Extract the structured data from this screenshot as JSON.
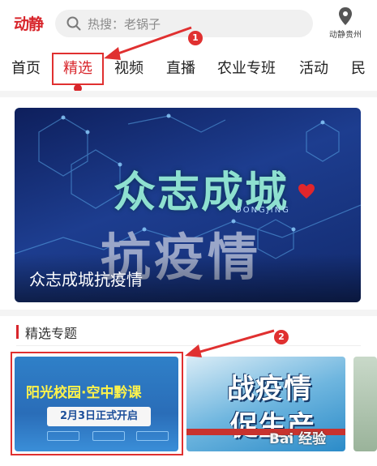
{
  "header": {
    "logo": "动静",
    "search_placeholder": "热搜：老锅子",
    "location_label": "动静贵州"
  },
  "tabs": [
    "首页",
    "精选",
    "视频",
    "直播",
    "农业专班",
    "活动",
    "民"
  ],
  "active_tab": "精选",
  "banner": {
    "headline": "众志成城",
    "brand": "DONGJING",
    "subline": "抗疫情",
    "caption": "众志成城抗疫情"
  },
  "section": {
    "title": "精选专题"
  },
  "cards": [
    {
      "title": "阳光校园·空中黔课",
      "date": "2月3日正式开启"
    },
    {
      "line1": "战疫情",
      "line2": "促生产"
    }
  ],
  "watermark": "Bai 经验",
  "annotations": [
    "1",
    "2"
  ],
  "colors": {
    "brand_red": "#d8262c",
    "annotation_red": "#e03030"
  }
}
